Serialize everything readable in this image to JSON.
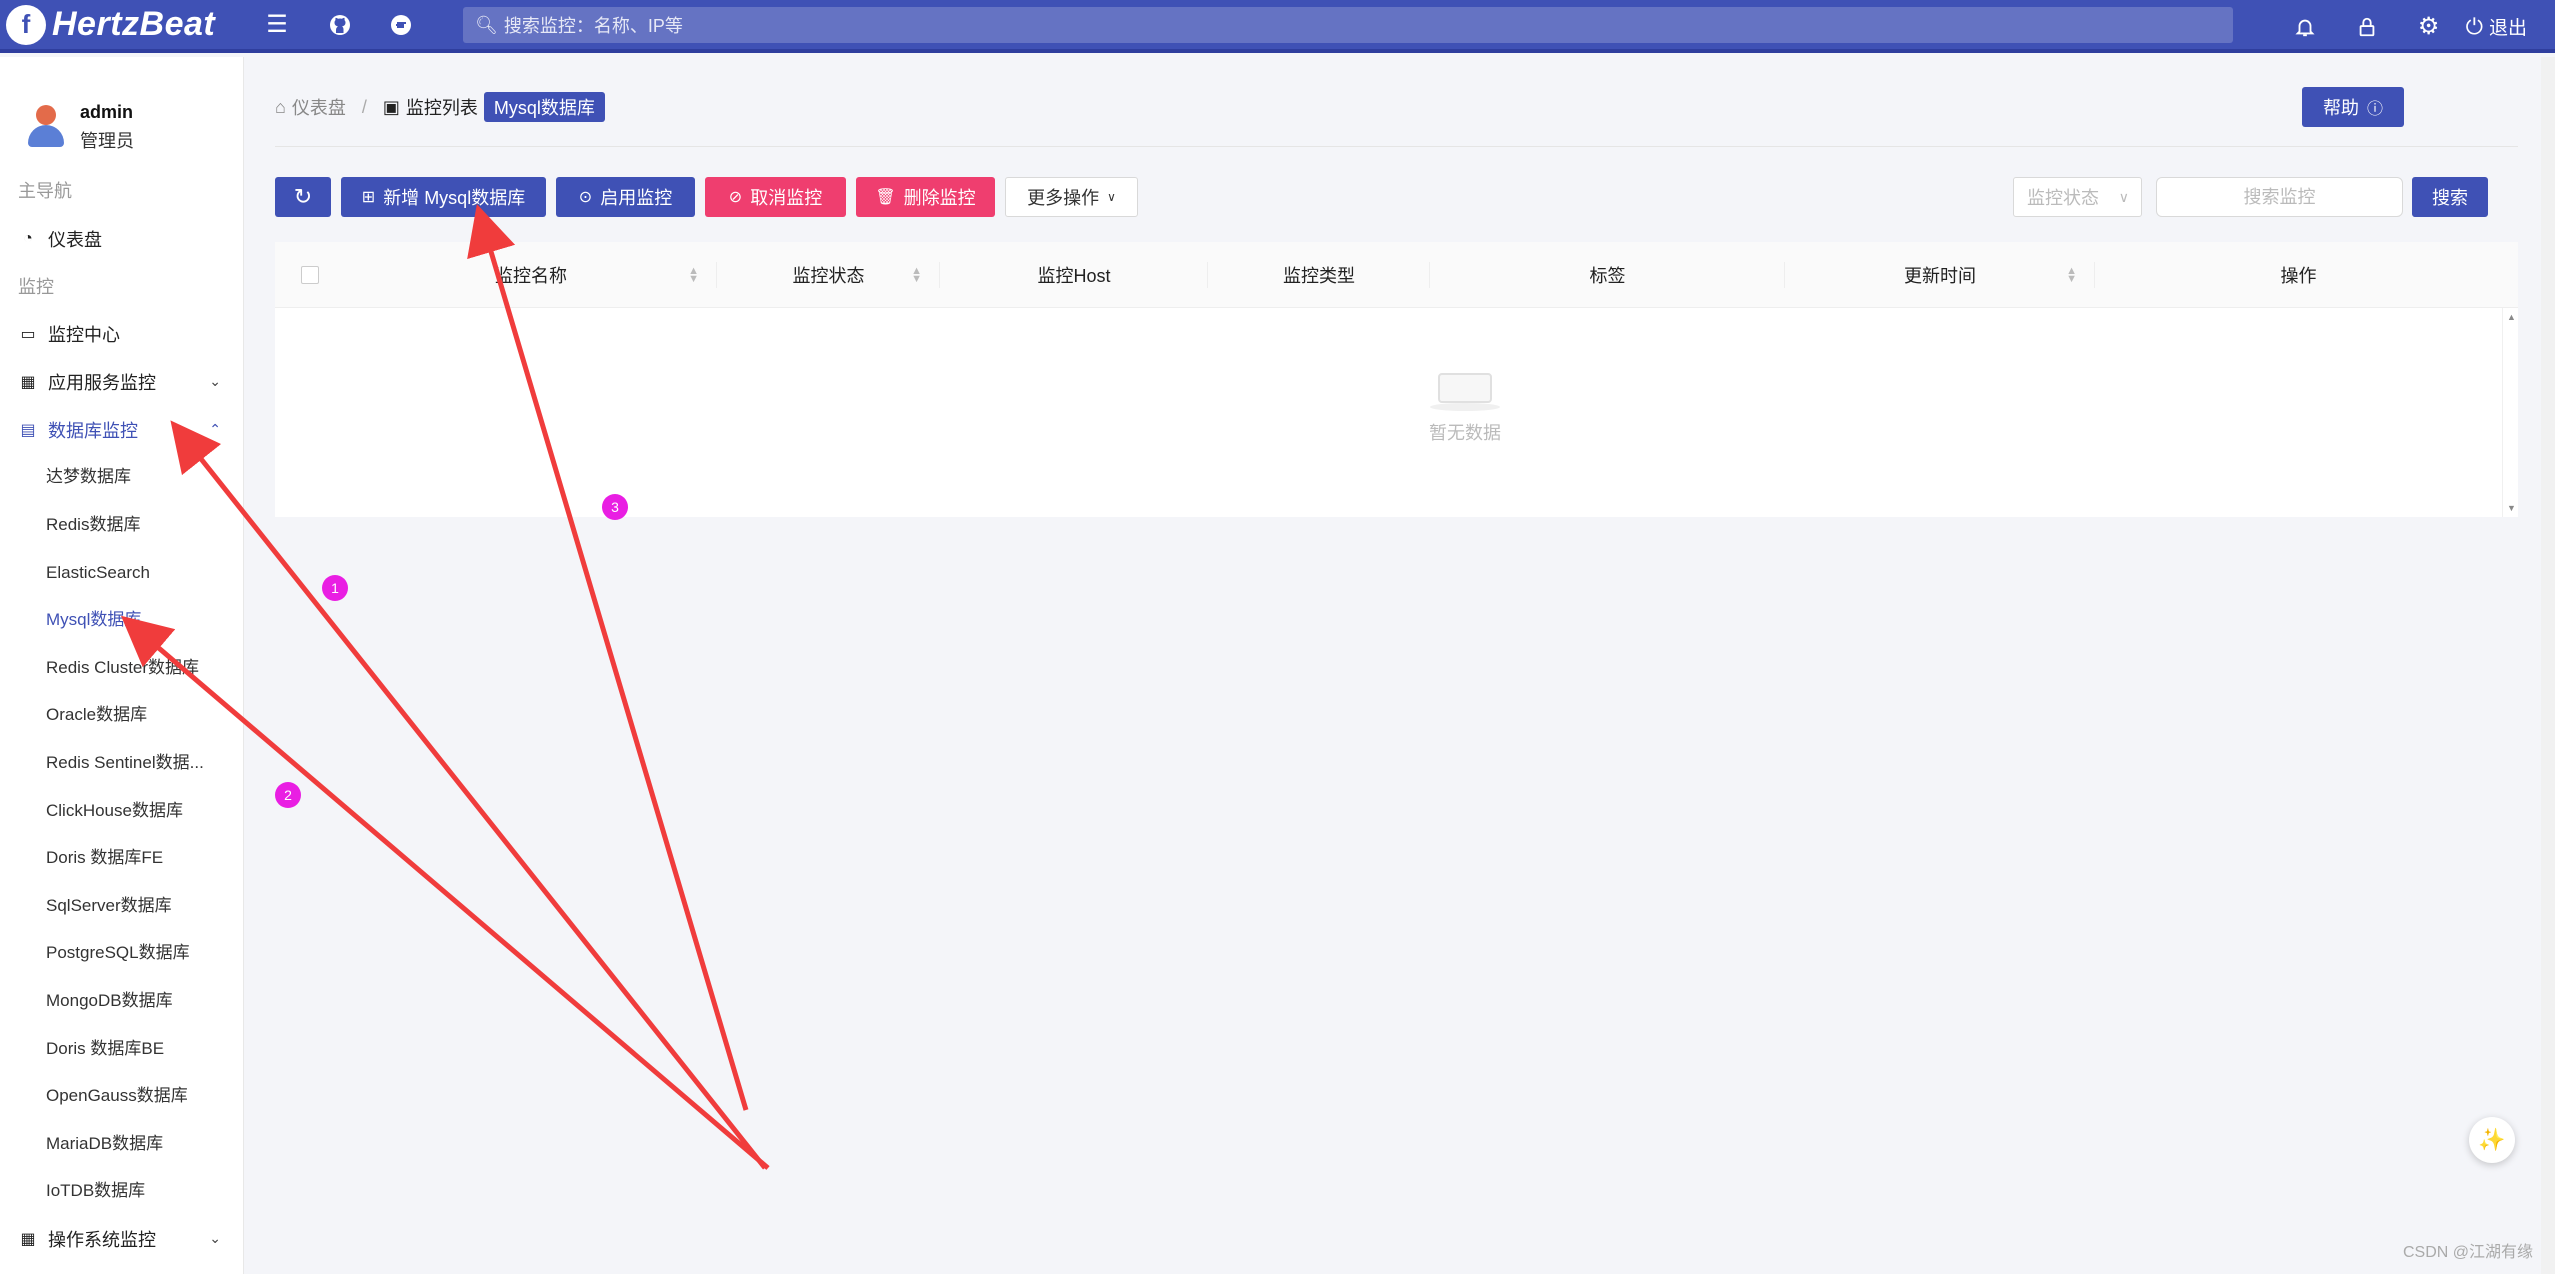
{
  "header": {
    "logo_letter": "f",
    "app_name": "HertzBeat",
    "search_placeholder": "搜索监控：名称、IP等",
    "logout_label": "退出",
    "icons": [
      "menu-icon",
      "github-icon",
      "gitee-icon",
      "bell-icon",
      "lock-icon",
      "gear-icon",
      "logout-icon"
    ]
  },
  "user": {
    "name": "admin",
    "role": "管理员"
  },
  "sidebar": {
    "group_main": "主导航",
    "dashboard": "仪表盘",
    "group_monitor": "监控",
    "monitor_center": "监控中心",
    "app_service": "应用服务监控",
    "database_monitor": "数据库监控",
    "db_items": [
      "达梦数据库",
      "Redis数据库",
      "ElasticSearch",
      "Mysql数据库",
      "Redis Cluster数据库",
      "Oracle数据库",
      "Redis Sentinel数据...",
      "ClickHouse数据库",
      "Doris 数据库FE",
      "SqlServer数据库",
      "PostgreSQL数据库",
      "MongoDB数据库",
      "Doris 数据库BE",
      "OpenGauss数据库",
      "MariaDB数据库",
      "IoTDB数据库"
    ],
    "os_monitor": "操作系统监控"
  },
  "breadcrumb": {
    "home": "仪表盘",
    "list": "监控列表",
    "current": "Mysql数据库"
  },
  "help_label": "帮助",
  "toolbar": {
    "add": "新增 Mysql数据库",
    "enable": "启用监控",
    "cancel": "取消监控",
    "delete": "删除监控",
    "more": "更多操作"
  },
  "filters": {
    "status_placeholder": "监控状态",
    "search_placeholder": "搜索监控",
    "search_button": "搜索"
  },
  "table": {
    "columns": [
      "监控名称",
      "监控状态",
      "监控Host",
      "监控类型",
      "标签",
      "更新时间",
      "操作"
    ],
    "empty_text": "暂无数据"
  },
  "annotations": [
    "1",
    "2",
    "3"
  ],
  "watermark": "CSDN @江湖有缘",
  "colors": {
    "primary": "#3f51b5",
    "danger": "#ef3e6f",
    "arrow": "#f03c3c",
    "badge": "#e91ee3"
  }
}
